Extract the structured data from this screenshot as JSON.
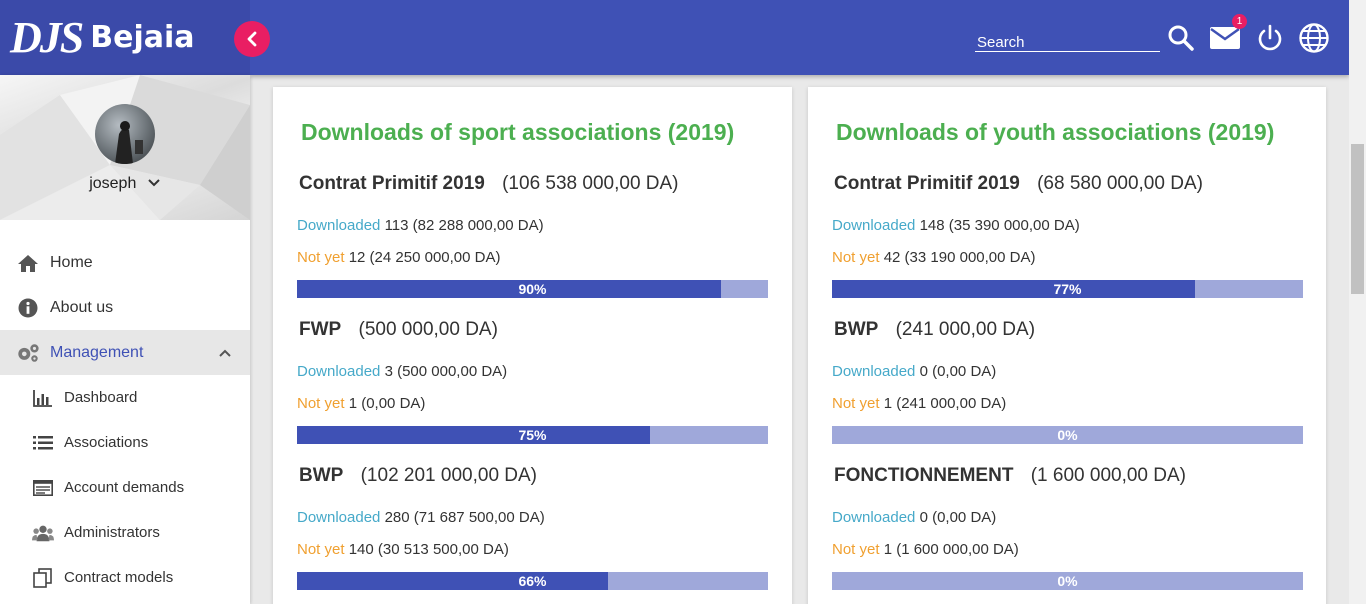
{
  "brand": {
    "mark": "DJS",
    "name": "Bejaia"
  },
  "header": {
    "search_placeholder": "Search",
    "mail_badge": "1",
    "colors": {
      "header": "#3f51b5",
      "logo_bg": "#3b4aa9",
      "accent": "#e91e63"
    },
    "icons": [
      "search-icon",
      "mail-icon",
      "power-icon",
      "globe-icon"
    ]
  },
  "profile": {
    "username": "joseph"
  },
  "sidebar": {
    "items": [
      {
        "label": "Home",
        "icon": "home-icon"
      },
      {
        "label": "About us",
        "icon": "info-icon"
      },
      {
        "label": "Management",
        "icon": "gears-icon"
      }
    ],
    "subitems": [
      {
        "label": "Dashboard",
        "icon": "bar-chart-icon"
      },
      {
        "label": "Associations",
        "icon": "list-icon"
      },
      {
        "label": "Account demands",
        "icon": "form-icon"
      },
      {
        "label": "Administrators",
        "icon": "users-icon"
      },
      {
        "label": "Contract models",
        "icon": "copy-icon"
      }
    ]
  },
  "labels": {
    "downloaded": "Downloaded",
    "not_yet": "Not yet"
  },
  "cards": [
    {
      "title": "Downloads of sport associations (2019)",
      "sections": [
        {
          "name": "Contrat Primitif 2019",
          "amount": "(106 538 000,00 DA)",
          "downloaded": "113 (82 288 000,00 DA)",
          "not_yet": "12 (24 250 000,00 DA)",
          "percent_label": "90%",
          "percent": 90
        },
        {
          "name": "FWP",
          "amount": "(500 000,00 DA)",
          "downloaded": "3 (500 000,00 DA)",
          "not_yet": "1 (0,00 DA)",
          "percent_label": "75%",
          "percent": 75
        },
        {
          "name": "BWP",
          "amount": "(102 201 000,00 DA)",
          "downloaded": "280 (71 687 500,00 DA)",
          "not_yet": "140 (30 513 500,00 DA)",
          "percent_label": "66%",
          "percent": 66
        }
      ]
    },
    {
      "title": "Downloads of youth associations (2019)",
      "sections": [
        {
          "name": "Contrat Primitif 2019",
          "amount": "(68 580 000,00 DA)",
          "downloaded": "148 (35 390 000,00 DA)",
          "not_yet": "42 (33 190 000,00 DA)",
          "percent_label": "77%",
          "percent": 77
        },
        {
          "name": "BWP",
          "amount": "(241 000,00 DA)",
          "downloaded": "0 (0,00 DA)",
          "not_yet": "1 (241 000,00 DA)",
          "percent_label": "0%",
          "percent": 0
        },
        {
          "name": "FONCTIONNEMENT",
          "amount": "(1 600 000,00 DA)",
          "downloaded": "0 (0,00 DA)",
          "not_yet": "1 (1 600 000,00 DA)",
          "percent_label": "0%",
          "percent": 0
        }
      ]
    }
  ]
}
